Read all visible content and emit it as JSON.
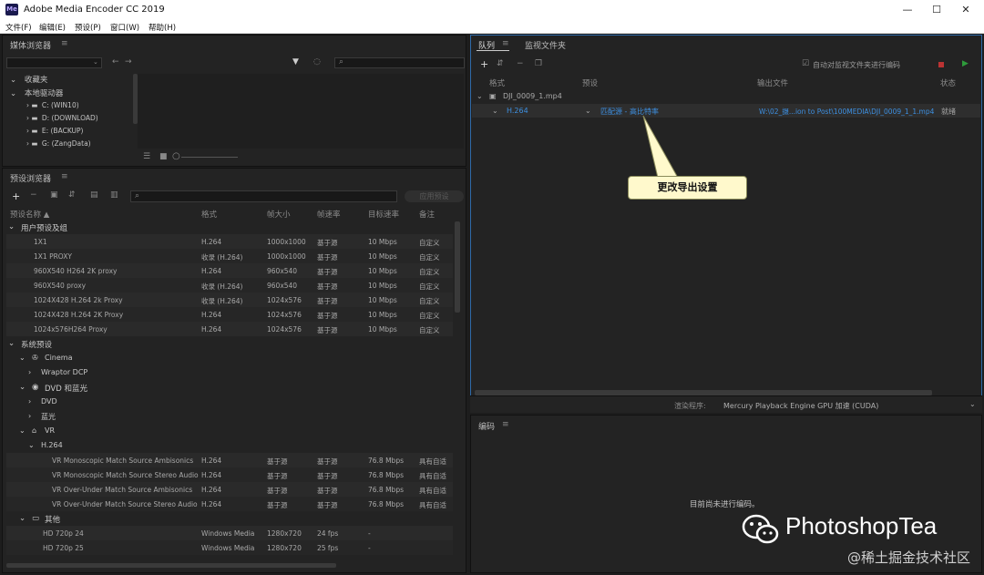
{
  "window": {
    "title": "Adobe Media Encoder CC 2019",
    "app_icon": "Me",
    "controls": [
      "—",
      "☐",
      "✕"
    ]
  },
  "menu": [
    "文件(F)",
    "编辑(E)",
    "预设(P)",
    "窗口(W)",
    "帮助(H)"
  ],
  "media_browser": {
    "title": "媒体浏览器",
    "favorites": "收藏夹",
    "local_drives": "本地驱动器",
    "drives": [
      "C: (WIN10)",
      "D: (DOWNLOAD)",
      "E: (BACKUP)",
      "G: (ZangData)"
    ]
  },
  "preset_browser": {
    "title": "预设浏览器",
    "apply_button": "应用预设",
    "columns": [
      "预设名称 ▲",
      "格式",
      "帧大小",
      "帧速率",
      "目标速率",
      "备注"
    ],
    "user_group": "用户预设及组",
    "user_presets": [
      [
        "1X1",
        "H.264",
        "1000x1000",
        "基于源",
        "10 Mbps",
        "自定义"
      ],
      [
        "1X1 PROXY",
        "收录 (H.264)",
        "1000x1000",
        "基于源",
        "10 Mbps",
        "自定义"
      ],
      [
        "960X540 H264 2K proxy",
        "H.264",
        "960x540",
        "基于源",
        "10 Mbps",
        "自定义"
      ],
      [
        "960X540 proxy",
        "收录 (H.264)",
        "960x540",
        "基于源",
        "10 Mbps",
        "自定义"
      ],
      [
        "1024X428 H.264 2k Proxy",
        "收录 (H.264)",
        "1024x576",
        "基于源",
        "10 Mbps",
        "自定义"
      ],
      [
        "1024X428 H.264 2K Proxy",
        "H.264",
        "1024x576",
        "基于源",
        "10 Mbps",
        "自定义"
      ],
      [
        "1024x576H264 Proxy",
        "H.264",
        "1024x576",
        "基于源",
        "10 Mbps",
        "自定义"
      ]
    ],
    "system_group": "系统预设",
    "cinema": "Cinema",
    "wraptor": "Wraptor DCP",
    "dvd_bluray": "DVD 和蓝光",
    "dvd": "DVD",
    "bluray": "蓝光",
    "vr": "VR",
    "h264": "H.264",
    "vr_presets": [
      [
        "VR Monoscopic Match Source Ambisonics",
        "H.264",
        "基于源",
        "基于源",
        "76.8 Mbps",
        "具有自适"
      ],
      [
        "VR Monoscopic Match Source Stereo Audio",
        "H.264",
        "基于源",
        "基于源",
        "76.8 Mbps",
        "具有自适"
      ],
      [
        "VR Over-Under Match Source Ambisonics",
        "H.264",
        "基于源",
        "基于源",
        "76.8 Mbps",
        "具有自适"
      ],
      [
        "VR Over-Under Match Source Stereo Audio",
        "H.264",
        "基于源",
        "基于源",
        "76.8 Mbps",
        "具有自适"
      ]
    ],
    "other": "其他",
    "other_presets": [
      [
        "HD 720p 24",
        "Windows Media",
        "1280x720",
        "24 fps",
        "-",
        ""
      ],
      [
        "HD 720p 25",
        "Windows Media",
        "1280x720",
        "25 fps",
        "-",
        ""
      ]
    ]
  },
  "queue": {
    "tab_queue": "队列",
    "tab_watch": "监视文件夹",
    "auto_encode": "自动对监视文件夹进行编码",
    "columns": [
      "格式",
      "预设",
      "输出文件",
      "状态"
    ],
    "source_file": "DJI_0009_1.mp4",
    "item": {
      "format": "H.264",
      "preset": "匹配源 - 高比特率",
      "output": "W:\\02_摄...ion to Post\\100MEDIA\\DJI_0009_1_1.mp4",
      "status": "就绪"
    },
    "renderer_label": "渲染程序:",
    "renderer_value": "Mercury Playback Engine GPU 加速 (CUDA)"
  },
  "callout": "更改导出设置",
  "encoding": {
    "title": "编码",
    "status": "目前尚未进行编码。"
  },
  "watermark": {
    "brand": "PhotoshopTea",
    "site": "@稀土掘金技术社区"
  }
}
